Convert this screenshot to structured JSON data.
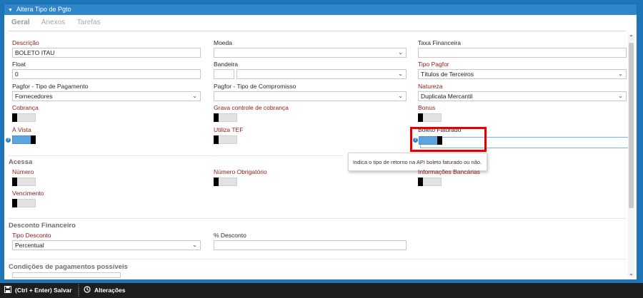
{
  "window": {
    "title": "Altera Tipo de Pgto"
  },
  "tabs": [
    {
      "label": "Geral"
    },
    {
      "label": "Anexos"
    },
    {
      "label": "Tarefas"
    }
  ],
  "fields": {
    "descricao": {
      "label": "Descrição",
      "value": "BOLETO ITAU"
    },
    "moeda": {
      "label": "Moeda",
      "value": ""
    },
    "taxa_financeira": {
      "label": "Taxa Financeira",
      "value": ""
    },
    "float": {
      "label": "Float",
      "value": "0"
    },
    "bandeira": {
      "label": "Bandeira",
      "value": ""
    },
    "tipo_pagfor": {
      "label": "Tipo Pagfor",
      "value": "Títulos de Terceiros"
    },
    "pagfor_tipo_pagamento": {
      "label": "Pagfor - Tipo de Pagamento",
      "value": "Fornecedores"
    },
    "pagfor_tipo_compromisso": {
      "label": "Pagfor - Tipo de Compromisso",
      "value": ""
    },
    "natureza": {
      "label": "Natureza",
      "value": "Duplicata Mercantil"
    },
    "tipo_desconto": {
      "label": "Tipo Desconto",
      "value": "Percentual"
    },
    "percent_desconto": {
      "label": "% Desconto",
      "value": ""
    }
  },
  "toggles": {
    "cobranca": {
      "label": "Cobrança",
      "on": false
    },
    "grava_controle": {
      "label": "Grava controle de cobrança",
      "on": false
    },
    "bonus": {
      "label": "Bonus",
      "on": false
    },
    "a_vista": {
      "label": "À Vista",
      "on": true
    },
    "utiliza_tef": {
      "label": "Utiliza TEF",
      "on": false
    },
    "boleto_faturado": {
      "label": "Boleto Faturado",
      "on": true
    },
    "numero": {
      "label": "Número",
      "on": false
    },
    "numero_obrigatorio": {
      "label": "Número Obrigatório",
      "on": false
    },
    "informacoes_bancarias": {
      "label": "Informações Bancárias",
      "on": false
    },
    "vencimento": {
      "label": "Vencimento",
      "on": false
    }
  },
  "sections": {
    "acessa": "Acessa",
    "desconto_financeiro": "Desconto Financeiro",
    "condicoes": "Condições de pagamentos possíveis"
  },
  "tooltip": {
    "text": "Indica o tipo de retorno na API boleto faturado ou não."
  },
  "footer": {
    "save_label": "(Ctrl + Enter) Salvar",
    "changes_label": "Alterações"
  },
  "colors": {
    "accent": "#2f86c8",
    "label_red": "#8b1a1a",
    "highlight": "#e30000",
    "toggle_on": "#5aa5de"
  },
  "icons": [
    "chevron-down-icon",
    "help-icon",
    "save-icon",
    "history-icon",
    "scroll-up-icon",
    "scroll-down-icon"
  ]
}
